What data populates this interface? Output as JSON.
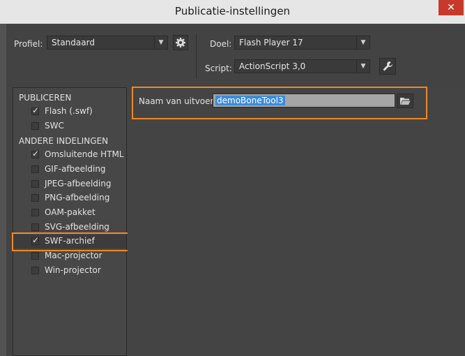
{
  "window": {
    "title": "Publicatie-instellingen",
    "close_glyph": "✕"
  },
  "header": {
    "profile_label": "Profiel:",
    "profile_value": "Standaard",
    "target_label": "Doel:",
    "target_value": "Flash Player 17",
    "script_label": "Script:",
    "script_value": "ActionScript 3,0"
  },
  "publish": {
    "section_title": "PUBLICEREN",
    "items": [
      {
        "label": "Flash (.swf)",
        "checked": true
      },
      {
        "label": "SWC",
        "checked": false
      }
    ]
  },
  "other_formats": {
    "section_title": "ANDERE INDELINGEN",
    "items": [
      {
        "label": "Omsluitende HTML",
        "checked": true
      },
      {
        "label": "GIF-afbeelding",
        "checked": false
      },
      {
        "label": "JPEG-afbeelding",
        "checked": false
      },
      {
        "label": "PNG-afbeelding",
        "checked": false
      },
      {
        "label": "OAM-pakket",
        "checked": false
      },
      {
        "label": "SVG-afbeelding",
        "checked": false
      },
      {
        "label": "SWF-archief",
        "checked": true
      },
      {
        "label": "Mac-projector",
        "checked": false
      },
      {
        "label": "Win-projector",
        "checked": false
      }
    ]
  },
  "output": {
    "label": "Naam van uitvoer:",
    "value": "demoBoneTool3"
  },
  "icons": {
    "settings": "gear-icon",
    "script_settings": "wrench-icon",
    "browse": "folder-icon",
    "dropdown": "chevron-down-icon"
  },
  "colors": {
    "highlight": "#f08a24",
    "selection": "#3d8bd8",
    "close_button": "#c7392a"
  }
}
